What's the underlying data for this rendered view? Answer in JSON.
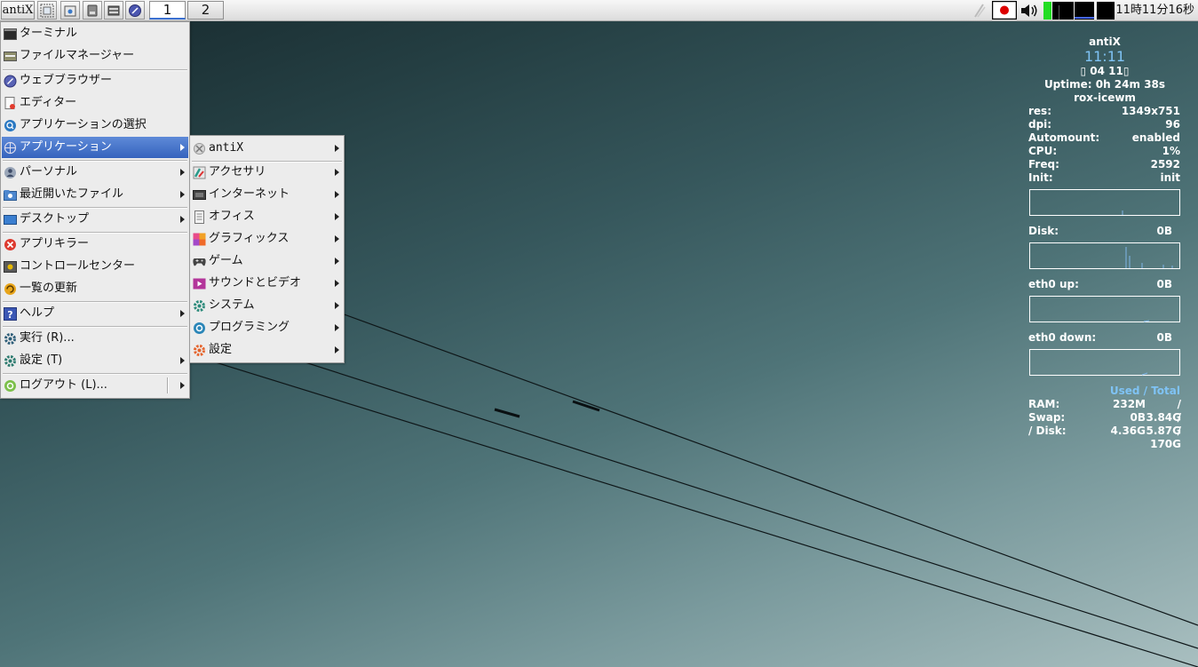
{
  "taskbar": {
    "start_label": "antiX",
    "quick_launch": [
      "fullscreen-icon",
      "file-manager-icon",
      "storage-icon",
      "window-list-icon",
      "browser-icon"
    ],
    "workspaces": [
      "1",
      "2"
    ],
    "active_workspace": "1",
    "clock": "11時11分16秒"
  },
  "menu": {
    "items": [
      {
        "label": "ターミナル",
        "icon": "terminal-icon"
      },
      {
        "label": "ファイルマネージャー",
        "icon": "file-manager-icon"
      },
      {
        "label": "ウェブブラウザー",
        "icon": "web-browser-icon"
      },
      {
        "label": "エディター",
        "icon": "editor-icon"
      },
      {
        "label": "アプリケーションの選択",
        "icon": "app-select-icon"
      },
      {
        "label": "アプリケーション",
        "icon": "applications-icon"
      },
      {
        "label": "パーソナル",
        "icon": "personal-icon"
      },
      {
        "label": "最近開いたファイル",
        "icon": "recent-files-icon"
      },
      {
        "label": "デスクトップ",
        "icon": "desktop-icon"
      },
      {
        "label": "アプリキラー",
        "icon": "app-killer-icon"
      },
      {
        "label": "コントロールセンター",
        "icon": "control-center-icon"
      },
      {
        "label": "一覧の更新",
        "icon": "refresh-icon"
      },
      {
        "label": "ヘルプ",
        "icon": "help-icon"
      },
      {
        "label": "実行 (R)...",
        "icon": "run-icon"
      },
      {
        "label": "設定 (T)",
        "icon": "settings-icon"
      },
      {
        "label": "ログアウト (L)...",
        "icon": "logout-icon"
      }
    ]
  },
  "submenu": {
    "items": [
      {
        "label": "antiX",
        "icon": "antix-icon"
      },
      {
        "label": "アクセサリ",
        "icon": "accessories-icon"
      },
      {
        "label": "インターネット",
        "icon": "internet-icon"
      },
      {
        "label": "オフィス",
        "icon": "office-icon"
      },
      {
        "label": "グラフィックス",
        "icon": "graphics-icon"
      },
      {
        "label": "ゲーム",
        "icon": "games-icon"
      },
      {
        "label": "サウンドとビデオ",
        "icon": "sound-video-icon"
      },
      {
        "label": "システム",
        "icon": "system-icon"
      },
      {
        "label": "プログラミング",
        "icon": "programming-icon"
      },
      {
        "label": "設定",
        "icon": "settings-icon"
      }
    ]
  },
  "conky": {
    "host": "antiX",
    "time": "11:11",
    "date": "04 11",
    "uptime": "Uptime: 0h 24m 38s",
    "wm": "rox-icewm",
    "stats": [
      {
        "key": "res:",
        "value": "1349x751"
      },
      {
        "key": "dpi:",
        "value": "96"
      },
      {
        "key": "Automount:",
        "value": "enabled"
      },
      {
        "key": "CPU:",
        "value": "1%"
      },
      {
        "key": "Freq:",
        "value": "2592"
      },
      {
        "key": "Init:",
        "value": "init"
      }
    ],
    "disk_label": "Disk:",
    "disk_value": "0B",
    "eth_up_label": "eth0 up:",
    "eth_up_value": "0B",
    "eth_down_label": "eth0 down:",
    "eth_down_value": "0B",
    "used_total_header": "Used / Total",
    "memory": [
      {
        "key": "RAM:",
        "used": "232M",
        "total": "/ 3.84G"
      },
      {
        "key": "Swap:",
        "used": "0B",
        "total": "/ 5.87G"
      },
      {
        "key": "/ Disk:",
        "used": "4.36G",
        "total": "/ 170G"
      }
    ]
  },
  "colors": {
    "menu_highlight": "#3e6cc6",
    "conky_accent": "#7fc3f5",
    "desktop_dark": "#17292d",
    "desktop_light": "#a9bfc0"
  }
}
